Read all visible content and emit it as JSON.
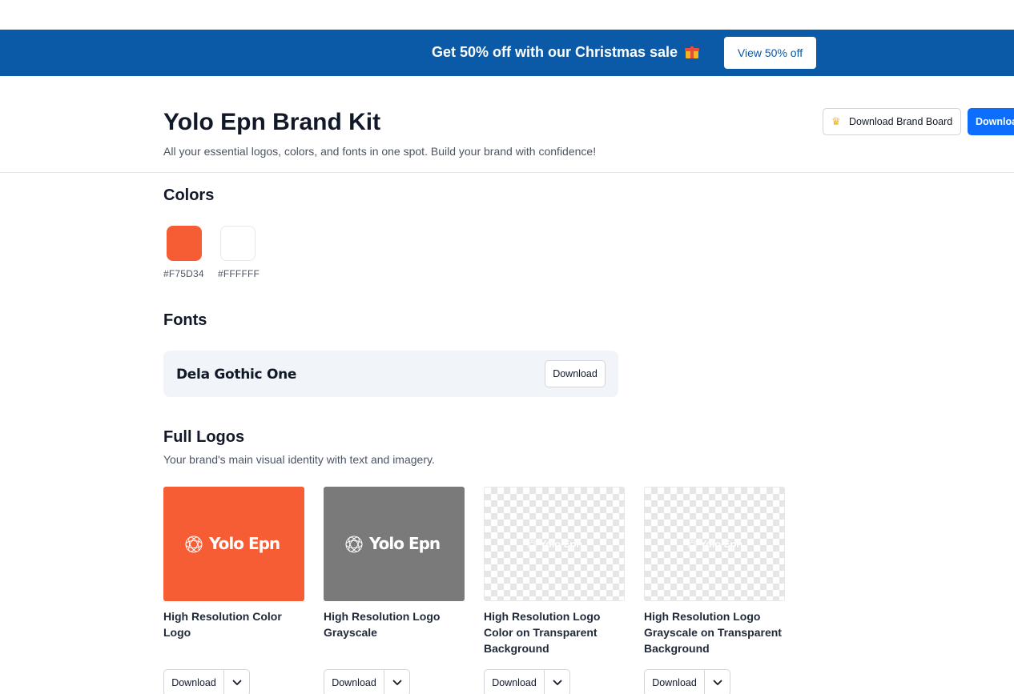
{
  "banner": {
    "text": "Get 50% off with our Christmas sale",
    "icon": "gift-icon",
    "button_label": "View 50% off",
    "background": "#0B5AA7"
  },
  "header": {
    "title": "Yolo Epn Brand Kit",
    "subtitle": "All your essential logos, colors, and fonts in one spot. Build your brand with confidence!",
    "download_board_label": "Download Brand Board",
    "download_board_icon": "crown-icon",
    "download_all_label": "Downloa"
  },
  "colors": {
    "heading": "Colors",
    "swatches": [
      {
        "hex": "#F75D34",
        "label": "#F75D34"
      },
      {
        "hex": "#FFFFFF",
        "label": "#FFFFFF"
      }
    ]
  },
  "fonts": {
    "heading": "Fonts",
    "items": [
      {
        "name": "Dela Gothic One",
        "download_label": "Download"
      }
    ]
  },
  "full_logos": {
    "heading": "Full Logos",
    "description": "Your brand's main visual identity with text and imagery.",
    "logo_word": "Yolo Epn",
    "cards": [
      {
        "title": "High Resolution Color Logo",
        "background": "#F75D34",
        "download_label": "Download"
      },
      {
        "title": "High Resolution Logo Grayscale",
        "background": "#7A7A7A",
        "download_label": "Download"
      },
      {
        "title": "High Resolution Logo Color on Transparent Background",
        "background": "transparent",
        "download_label": "Download"
      },
      {
        "title": "High Resolution Logo Grayscale on Transparent Background",
        "background": "transparent",
        "download_label": "Download"
      }
    ]
  }
}
